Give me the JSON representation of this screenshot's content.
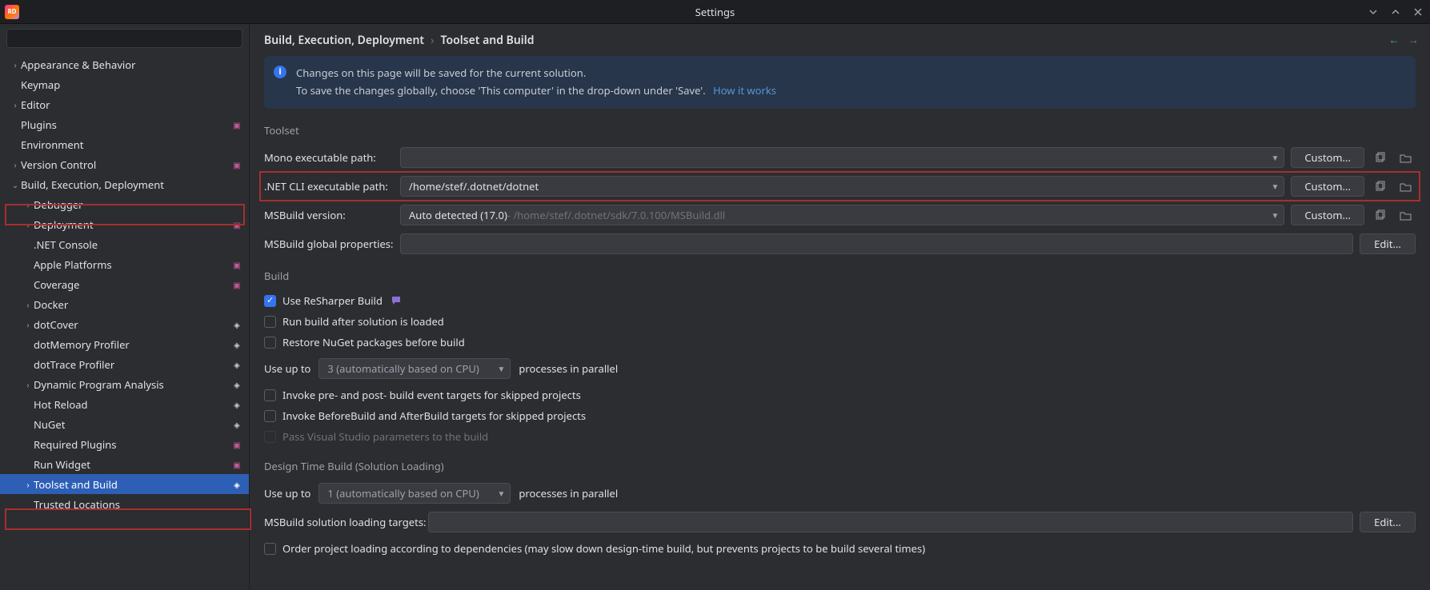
{
  "window": {
    "title": "Settings",
    "app_icon_text": "RD"
  },
  "search": {
    "placeholder": ""
  },
  "sidebar": {
    "items": [
      {
        "label": "Appearance & Behavior",
        "level": 0,
        "chev": ">",
        "badge": ""
      },
      {
        "label": "Keymap",
        "level": 0,
        "chev": "",
        "badge": ""
      },
      {
        "label": "Editor",
        "level": 0,
        "chev": ">",
        "badge": ""
      },
      {
        "label": "Plugins",
        "level": 0,
        "chev": "",
        "badge": "pink"
      },
      {
        "label": "Environment",
        "level": 0,
        "chev": "",
        "badge": ""
      },
      {
        "label": "Version Control",
        "level": 0,
        "chev": ">",
        "badge": "pink"
      },
      {
        "label": "Build, Execution, Deployment",
        "level": 0,
        "chev": "v",
        "badge": ""
      },
      {
        "label": "Debugger",
        "level": 1,
        "chev": ">",
        "badge": ""
      },
      {
        "label": "Deployment",
        "level": 1,
        "chev": ">",
        "badge": "pink"
      },
      {
        "label": ".NET Console",
        "level": 1,
        "chev": "",
        "badge": ""
      },
      {
        "label": "Apple Platforms",
        "level": 1,
        "chev": "",
        "badge": "pink"
      },
      {
        "label": "Coverage",
        "level": 1,
        "chev": "",
        "badge": "pink"
      },
      {
        "label": "Docker",
        "level": 1,
        "chev": ">",
        "badge": ""
      },
      {
        "label": "dotCover",
        "level": 1,
        "chev": ">",
        "badge": "stack"
      },
      {
        "label": "dotMemory Profiler",
        "level": 1,
        "chev": "",
        "badge": "stack"
      },
      {
        "label": "dotTrace Profiler",
        "level": 1,
        "chev": "",
        "badge": "stack"
      },
      {
        "label": "Dynamic Program Analysis",
        "level": 1,
        "chev": ">",
        "badge": "stack"
      },
      {
        "label": "Hot Reload",
        "level": 1,
        "chev": "",
        "badge": "stack"
      },
      {
        "label": "NuGet",
        "level": 1,
        "chev": "",
        "badge": "stack"
      },
      {
        "label": "Required Plugins",
        "level": 1,
        "chev": "",
        "badge": "pink"
      },
      {
        "label": "Run Widget",
        "level": 1,
        "chev": "",
        "badge": "pink"
      },
      {
        "label": "Toolset and Build",
        "level": 1,
        "chev": ">",
        "badge": "stack",
        "selected": true
      },
      {
        "label": "Trusted Locations",
        "level": 1,
        "chev": "",
        "badge": ""
      }
    ]
  },
  "breadcrumbs": {
    "a": "Build, Execution, Deployment",
    "b": "Toolset and Build"
  },
  "notice": {
    "line1": "Changes on this page will be saved for the current solution.",
    "line2": "To save the changes globally, choose 'This computer' in the drop-down under 'Save'.",
    "link": "How it works"
  },
  "sections": {
    "toolset": "Toolset",
    "build": "Build",
    "design": "Design Time Build (Solution Loading)"
  },
  "fields": {
    "mono_label": "Mono executable path:",
    "mono_value": "",
    "netcli_label": ".NET CLI executable path:",
    "netcli_value": "/home/stef/.dotnet/dotnet",
    "msb_ver_label": "MSBuild version:",
    "msb_ver_main": "Auto detected (17.0)",
    "msb_ver_path": " - /home/stef/.dotnet/sdk/7.0.100/MSBuild.dll",
    "msb_global_label": "MSBuild global properties:",
    "msb_global_value": "",
    "msb_targets_label": "MSBuild solution loading targets:",
    "msb_targets_value": ""
  },
  "buttons": {
    "custom": "Custom...",
    "edit": "Edit..."
  },
  "checks": {
    "resharper": "Use ReSharper Build",
    "runafter": "Run build after solution is loaded",
    "restore": "Restore NuGet packages before build",
    "invoke_prepost": "Invoke pre- and post- build event targets for skipped projects",
    "invoke_before": "Invoke BeforeBuild and AfterBuild targets for skipped projects",
    "pass_vs": "Pass Visual Studio parameters to the build",
    "order_loading": "Order project loading according to dependencies (may slow down design-time build, but prevents projects to be build several times)"
  },
  "parallel": {
    "prefix": "Use up to",
    "value": "3 (automatically based on CPU)",
    "value2": "1 (automatically based on CPU)",
    "suffix": "processes in parallel"
  }
}
